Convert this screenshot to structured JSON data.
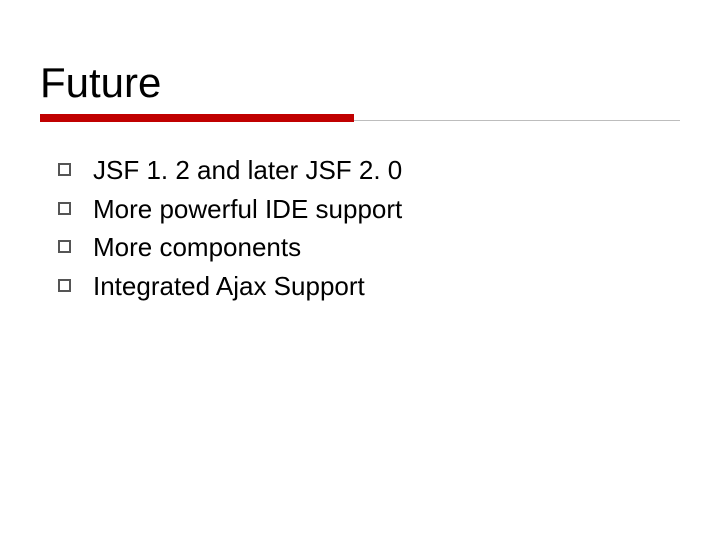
{
  "slide": {
    "title": "Future",
    "underline_red_width_pct": 49,
    "bullets": [
      {
        "text": "JSF 1. 2 and later JSF 2. 0"
      },
      {
        "text": "More powerful IDE support"
      },
      {
        "text": "More components"
      },
      {
        "text": "Integrated Ajax Support"
      }
    ]
  }
}
